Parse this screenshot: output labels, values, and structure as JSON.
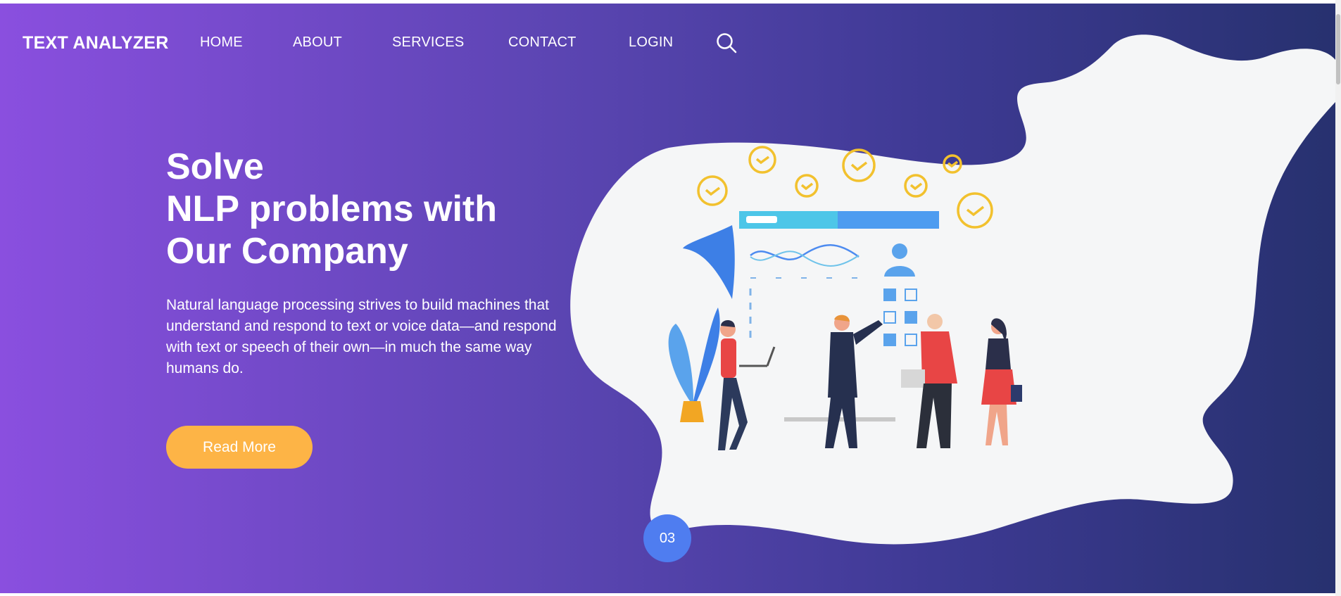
{
  "brand": {
    "name": "TEXT ANALYZER"
  },
  "nav": {
    "items": [
      {
        "label": "HOME"
      },
      {
        "label": "ABOUT"
      },
      {
        "label": "SERVICES"
      },
      {
        "label": "CONTACT"
      },
      {
        "label": "LOGIN"
      }
    ],
    "search_icon": "search-icon"
  },
  "hero": {
    "headline": [
      "Solve",
      "NLP problems with",
      "Our Company"
    ],
    "description": "Natural language processing strives to build machines that understand and respond to text or voice data—and respond with text or speech of their own—in much the same way humans do.",
    "cta_label": "Read More",
    "slide_number": "03"
  },
  "colors": {
    "gradient_start": "#8a4fdf",
    "gradient_end": "#27316f",
    "blob": "#f5f6f7",
    "cta": "#fdb446",
    "badge": "#4f7df0",
    "accent_yellow": "#f2c12e",
    "accent_blue": "#4d8bf0"
  }
}
